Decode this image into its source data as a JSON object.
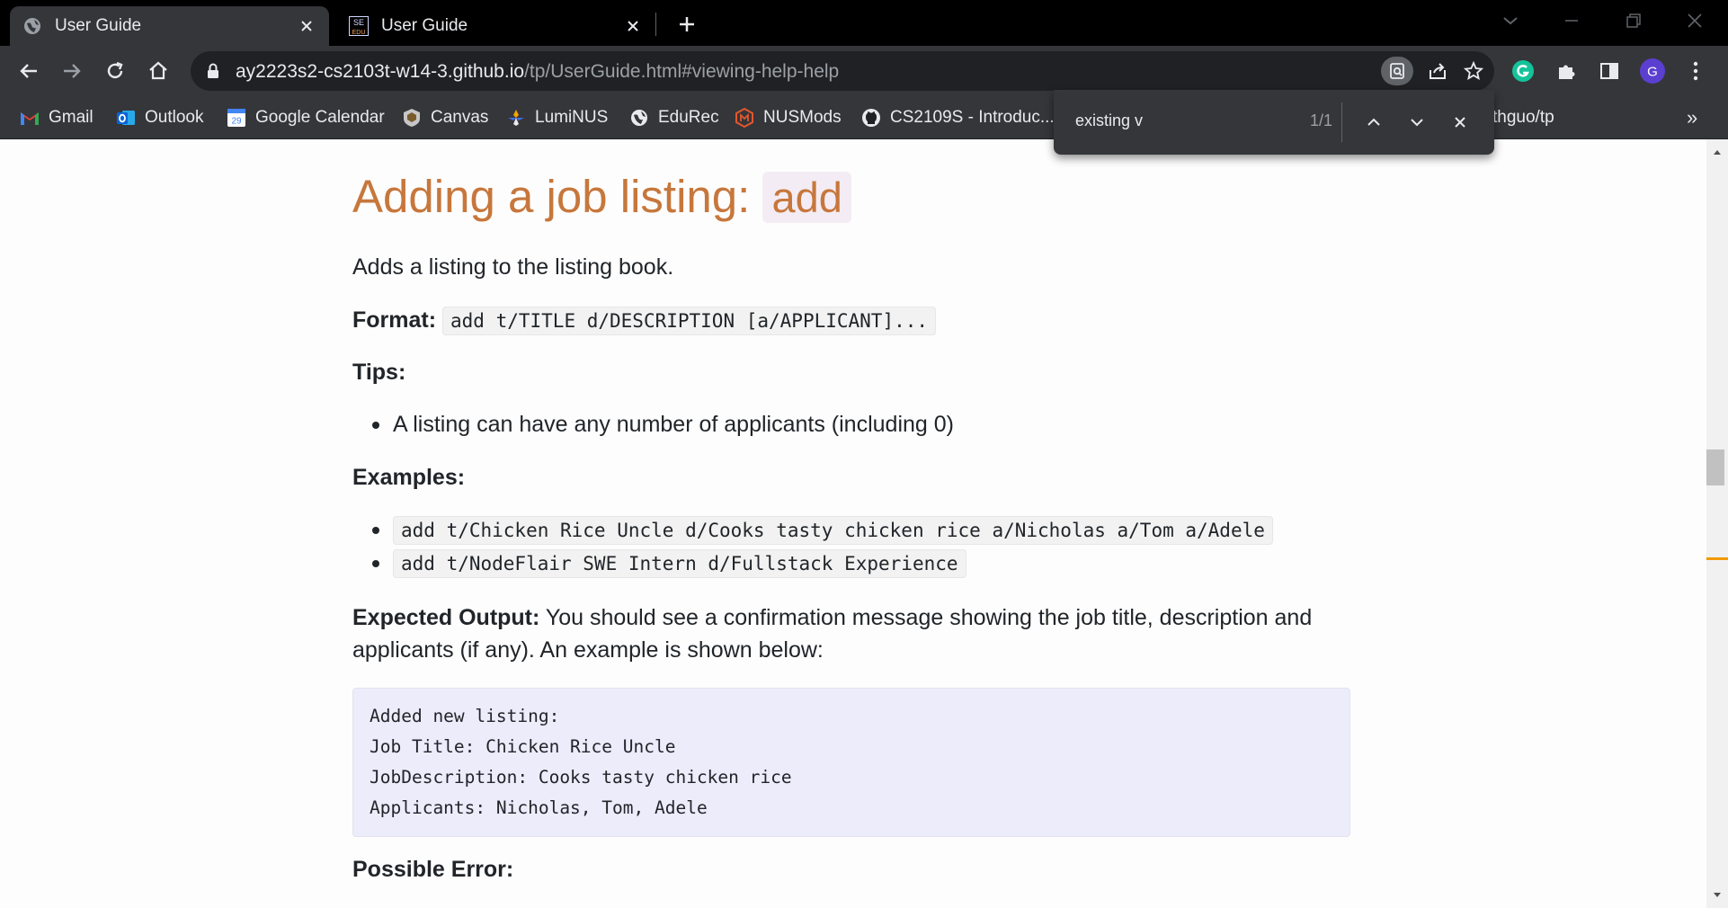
{
  "tabs": [
    {
      "title": "User Guide",
      "icon": "globe-icon"
    },
    {
      "title": "User Guide",
      "icon": "se-edu-icon",
      "favicon_text_top": "SE",
      "favicon_text_bottom": "EDU"
    }
  ],
  "omnibox": {
    "url_host": "ay2223s2-cs2103t-w14-3.github.io",
    "url_path": "/tp/UserGuide.html#viewing-help-help"
  },
  "extension_avatar_letter": "G",
  "bookmarks": [
    {
      "label": "Gmail",
      "icon": "gmail-icon",
      "color": "#ea4335"
    },
    {
      "label": "Outlook",
      "icon": "outlook-icon",
      "color": "#0a64d6"
    },
    {
      "label": "Google Calendar",
      "icon": "calendar-icon",
      "color": "#4285f4",
      "icon_text": "29"
    },
    {
      "label": "Canvas",
      "icon": "canvas-icon",
      "color": "#c7c7c7"
    },
    {
      "label": "LumiNUS",
      "icon": "luminus-icon",
      "color": "#3d6ee6"
    },
    {
      "label": "EduRec",
      "icon": "globe-icon",
      "color": "#e8eaed"
    },
    {
      "label": "NUSMods",
      "icon": "nusmods-icon",
      "color": "#e4572e"
    },
    {
      "label": "CS2109S - Introduc...",
      "icon": "github-icon",
      "color": "#e8eaed"
    },
    {
      "label": "thguo/tp",
      "icon": "",
      "color": "#e8eaed"
    }
  ],
  "bookmarks_overflow": "»",
  "find": {
    "query": "existing v",
    "count": "1/1"
  },
  "doc": {
    "heading_text": "Adding a job listing: ",
    "heading_code": "add",
    "intro": "Adds a listing to the listing book.",
    "format_label": "Format:",
    "format_code": "add t/TITLE d/DESCRIPTION [a/APPLICANT]...",
    "tips_label": "Tips:",
    "tips": [
      "A listing can have any number of applicants (including 0)"
    ],
    "examples_label": "Examples:",
    "examples": [
      "add t/Chicken Rice Uncle d/Cooks tasty chicken rice a/Nicholas a/Tom a/Adele",
      "add t/NodeFlair SWE Intern d/Fullstack Experience"
    ],
    "expected_label": "Expected Output:",
    "expected_line1": " You should see a confirmation message showing the job title, description and",
    "expected_line2": "applicants (if any). An example is shown below:",
    "output_lines": [
      "Added new listing:",
      "Job Title: Chicken Rice Uncle",
      "JobDescription: Cooks tasty chicken rice",
      "Applicants: Nicholas, Tom, Adele"
    ],
    "possible_error_label": "Possible Error:"
  },
  "colors": {
    "heading": "#c7773c",
    "find_match_marker": "#f29900",
    "grammarly": "#15c39a",
    "avatar": "#5b3fd1"
  }
}
